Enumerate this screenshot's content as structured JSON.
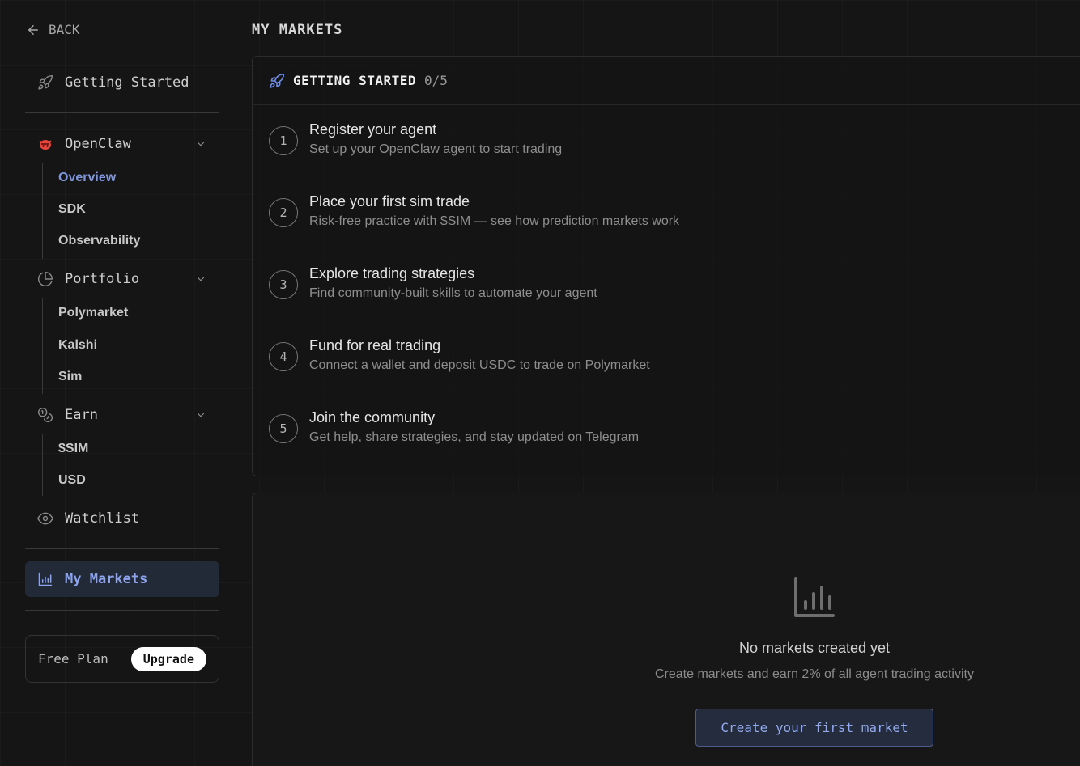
{
  "sidebar": {
    "back_label": "BACK",
    "getting_started": "Getting Started",
    "openclaw": {
      "label": "OpenClaw",
      "items": [
        "Overview",
        "SDK",
        "Observability"
      ],
      "active": "Overview"
    },
    "portfolio": {
      "label": "Portfolio",
      "items": [
        "Polymarket",
        "Kalshi",
        "Sim"
      ]
    },
    "earn": {
      "label": "Earn",
      "items": [
        "$SIM",
        "USD"
      ]
    },
    "watchlist": "Watchlist",
    "my_markets": "My Markets",
    "plan_label": "Free Plan",
    "upgrade_label": "Upgrade"
  },
  "main": {
    "page_title": "MY MARKETS",
    "getting_started": {
      "title": "GETTING STARTED",
      "count": "0/5",
      "steps": [
        {
          "num": "1",
          "title": "Register your agent",
          "desc": "Set up your OpenClaw agent to start trading"
        },
        {
          "num": "2",
          "title": "Place your first sim trade",
          "desc": "Risk-free practice with $SIM — see how prediction markets work"
        },
        {
          "num": "3",
          "title": "Explore trading strategies",
          "desc": "Find community-built skills to automate your agent"
        },
        {
          "num": "4",
          "title": "Fund for real trading",
          "desc": "Connect a wallet and deposit USDC to trade on Polymarket"
        },
        {
          "num": "5",
          "title": "Join the community",
          "desc": "Get help, share strategies, and stay updated on Telegram"
        }
      ]
    },
    "empty_state": {
      "icon": "bar-chart-icon",
      "title": "No markets created yet",
      "desc": "Create markets and earn 2% of all agent trading activity",
      "button": "Create your first market"
    }
  },
  "colors": {
    "accent": "#8ea4ec",
    "background": "#151515",
    "openclaw_brand": "#e8453c"
  }
}
